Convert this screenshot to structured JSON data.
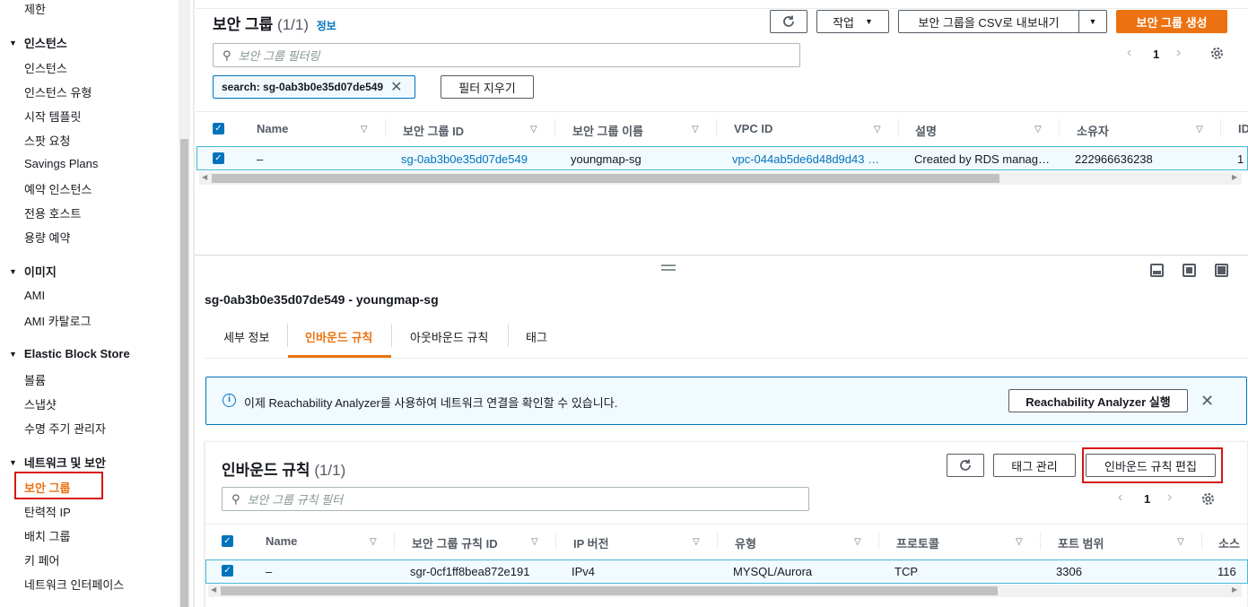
{
  "sidebar": {
    "top_item": "제한",
    "sections": [
      {
        "title": "인스턴스",
        "items": [
          "인스턴스",
          "인스턴스 유형",
          "시작 템플릿",
          "스팟 요청",
          "Savings Plans",
          "예약 인스턴스",
          "전용 호스트",
          "용량 예약"
        ]
      },
      {
        "title": "이미지",
        "items": [
          "AMI",
          "AMI 카탈로그"
        ]
      },
      {
        "title": "Elastic Block Store",
        "items": [
          "볼륨",
          "스냅샷",
          "수명 주기 관리자"
        ]
      },
      {
        "title": "네트워크 및 보안",
        "items": [
          "보안 그룹",
          "탄력적 IP",
          "배치 그룹",
          "키 페어",
          "네트워크 인터페이스"
        ]
      }
    ],
    "active_item": "보안 그룹"
  },
  "top_panel": {
    "title": "보안 그룹",
    "count": "(1/1)",
    "info_link": "정보",
    "actions_label": "작업",
    "export_label": "보안 그룹을 CSV로 내보내기",
    "create_label": "보안 그룹 생성",
    "search_placeholder": "보안 그룹 필터링",
    "filter_token": "search: sg-0ab3b0e35d07de549",
    "clear_filters_label": "필터 지우기",
    "page_number": "1",
    "columns": [
      "Name",
      "보안 그룹 ID",
      "보안 그룹 이름",
      "VPC ID",
      "설명",
      "소유자"
    ],
    "row": {
      "name": "–",
      "group_id": "sg-0ab3b0e35d07de549",
      "group_name": "youngmap-sg",
      "vpc_id": "vpc-044ab5de6d48d9d43 …",
      "description": "Created by RDS manag…",
      "owner": "222966636238",
      "trunc": "1"
    }
  },
  "detail_panel": {
    "title": "sg-0ab3b0e35d07de549 - youngmap-sg",
    "tabs": [
      "세부 정보",
      "인바운드 규칙",
      "아웃바운드 규칙",
      "태그"
    ],
    "active_tab": "인바운드 규칙",
    "alert_text": "이제 Reachability Analyzer를 사용하여 네트워크 연결을 확인할 수 있습니다.",
    "alert_button": "Reachability Analyzer 실행",
    "rules_title": "인바운드 규칙",
    "rules_count": "(1/1)",
    "manage_tags_label": "태그 관리",
    "edit_rules_label": "인바운드 규칙 편집",
    "rules_search_placeholder": "보안 그룹 규칙 필터",
    "page_number": "1",
    "columns": [
      "Name",
      "보안 그룹 규칙 ID",
      "IP 버전",
      "유형",
      "프로토콜",
      "포트 범위",
      "소스"
    ],
    "row": {
      "name": "–",
      "rule_id": "sgr-0cf1ff8bea872e191",
      "ip_version": "IPv4",
      "type": "MYSQL/Aurora",
      "protocol": "TCP",
      "port_range": "3306",
      "source": "116"
    }
  },
  "colors": {
    "accent": "#ec7211",
    "link": "#0073bb",
    "highlight_box": "#d91515",
    "info_bg": "#f1faff"
  }
}
